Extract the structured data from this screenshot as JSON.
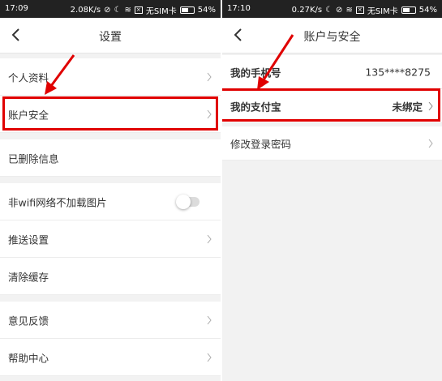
{
  "left_screen": {
    "status_bar": {
      "time": "17:09",
      "speed": "2.08K/s",
      "sim": "无SIM卡",
      "battery": "54%",
      "battery_level": 0.54
    },
    "title": "设置",
    "items": [
      {
        "label": "个人资料"
      },
      {
        "label": "账户安全"
      },
      {
        "label": "已删除信息"
      },
      {
        "label": "非wifi网络不加载图片",
        "toggle_on": false
      },
      {
        "label": "推送设置"
      },
      {
        "label": "清除缓存"
      },
      {
        "label": "意见反馈"
      },
      {
        "label": "帮助中心"
      }
    ]
  },
  "right_screen": {
    "status_bar": {
      "time": "17:10",
      "speed": "0.27K/s",
      "sim": "无SIM卡",
      "battery": "54%",
      "battery_level": 0.54
    },
    "title": "账户与安全",
    "items": [
      {
        "label": "我的手机号",
        "value": "135****8275"
      },
      {
        "label": "我的支付宝",
        "value": "未绑定"
      },
      {
        "label": "修改登录密码"
      }
    ]
  },
  "colors": {
    "highlight": "#e00000",
    "background": "#f2f2f2",
    "text": "#333333"
  }
}
